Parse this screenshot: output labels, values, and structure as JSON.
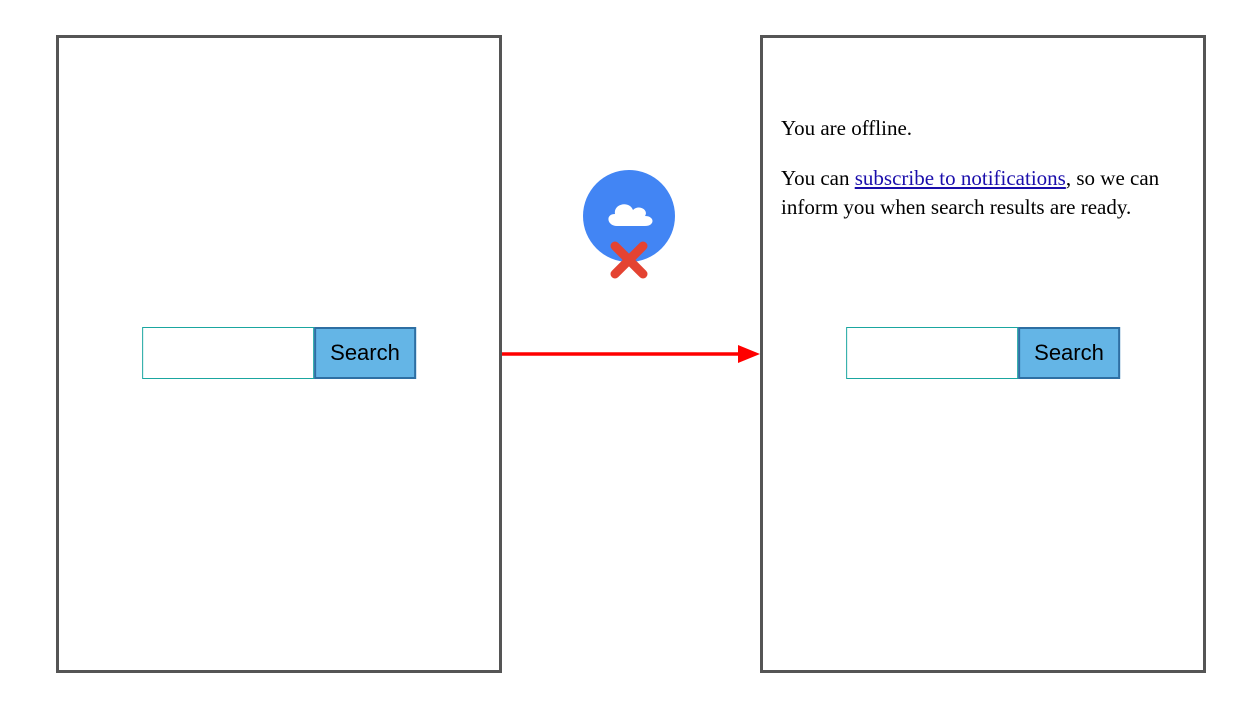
{
  "left": {
    "search_button": "Search",
    "search_value": ""
  },
  "right": {
    "search_button": "Search",
    "search_value": "",
    "offline_msg": "You are offline.",
    "subscribe_pre": "You can ",
    "subscribe_link": "subscribe to notifications",
    "subscribe_post": ", so we can inform you when search results are ready."
  },
  "icon": {
    "name": "offline-cloud-x"
  },
  "colors": {
    "cloud_bg": "#4285f4",
    "x_red": "#e44332",
    "arrow_red": "#ff0000",
    "button_bg": "#64b5e6",
    "button_border": "#2e6fa3",
    "input_border": "#1aa6a0"
  }
}
